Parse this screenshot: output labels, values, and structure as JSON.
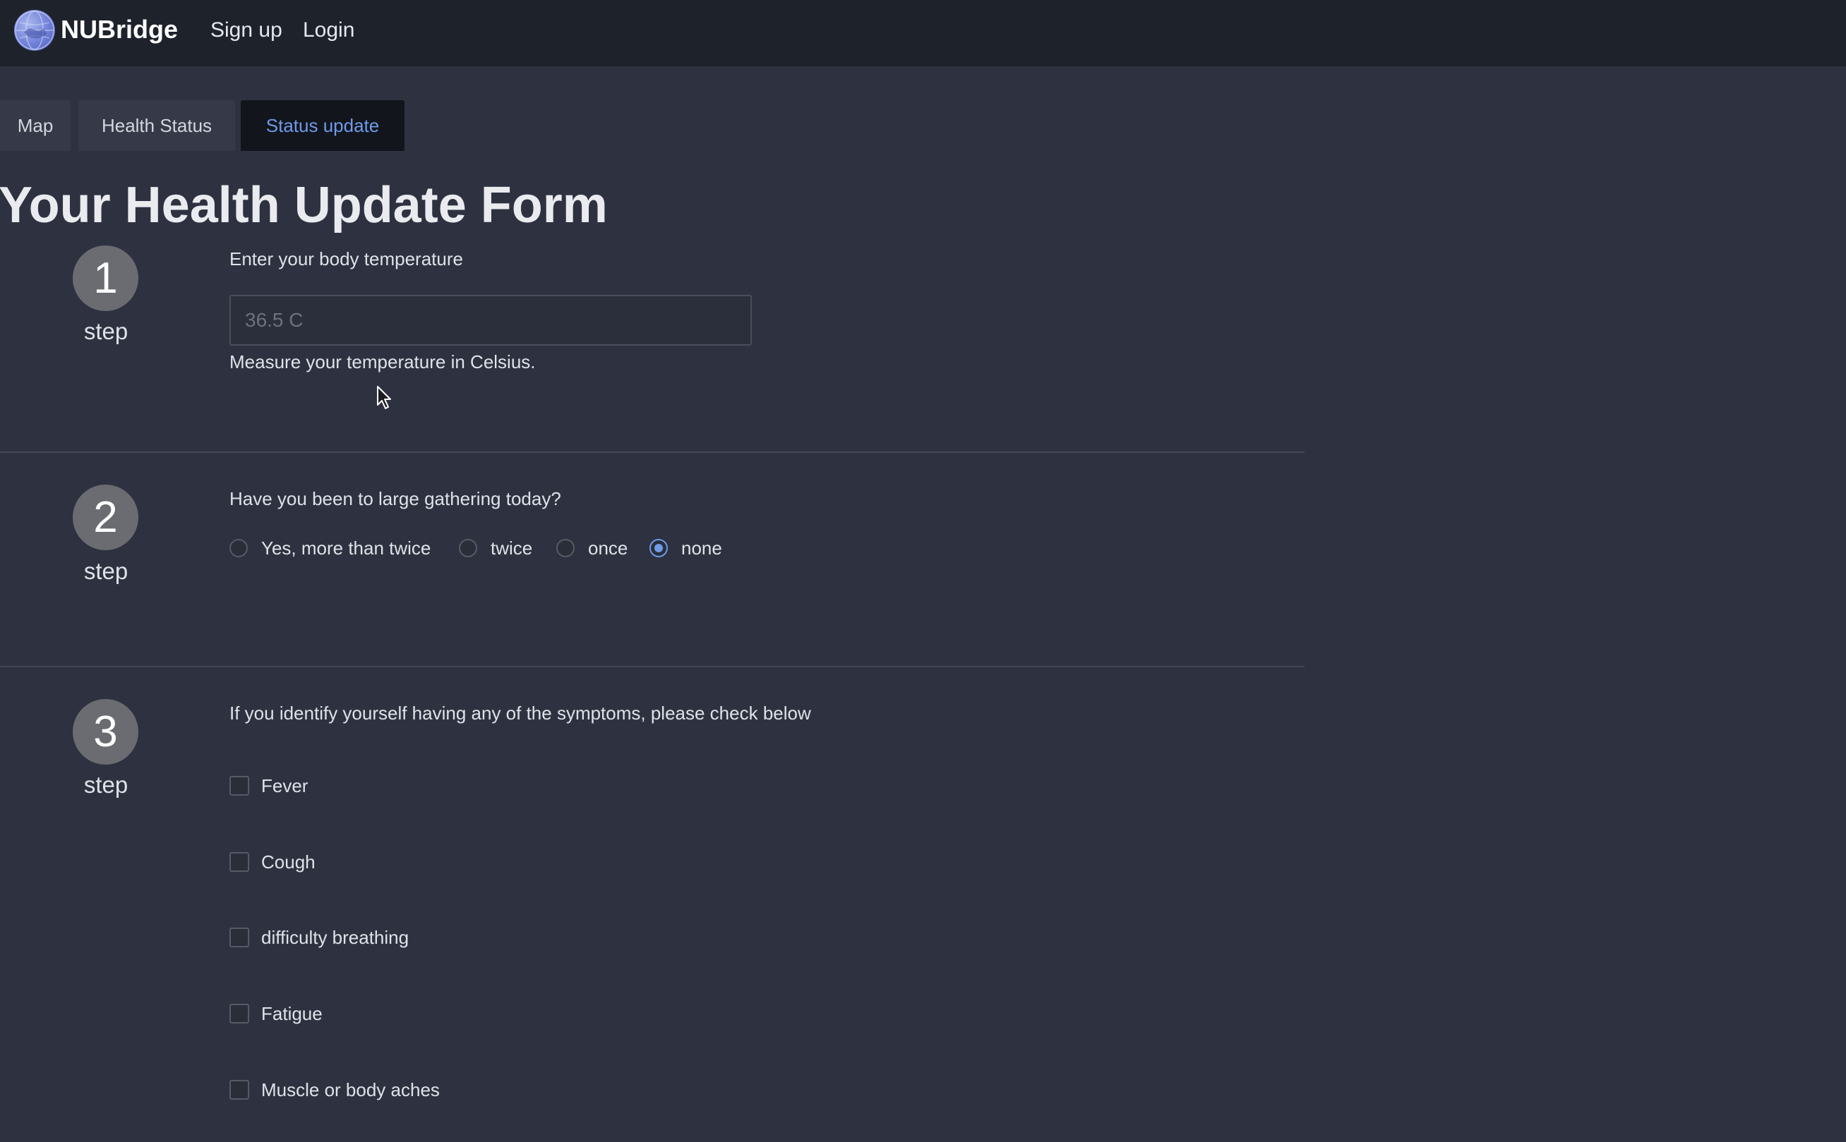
{
  "navbar": {
    "brand": "NUBridge",
    "logo_icon": "globe-icon",
    "links": [
      "Sign up",
      "Login"
    ]
  },
  "tabs": [
    {
      "label": "Map",
      "active": false
    },
    {
      "label": "Health Status",
      "active": false
    },
    {
      "label": "Status update",
      "active": true
    }
  ],
  "page_title": "Your Health Update Form",
  "step_word": "step",
  "steps": {
    "one": {
      "number": "1",
      "question": "Enter your body temperature",
      "input_placeholder": "36.5 C",
      "input_value": "",
      "helper": "Measure your temperature in Celsius."
    },
    "two": {
      "number": "2",
      "question": "Have you been to large gathering today?",
      "options": [
        {
          "label": "Yes, more than twice",
          "checked": false
        },
        {
          "label": "twice",
          "checked": false
        },
        {
          "label": "once",
          "checked": false
        },
        {
          "label": "none",
          "checked": true
        }
      ]
    },
    "three": {
      "number": "3",
      "question": "If you identify yourself having any of the symptoms, please check below",
      "symptoms": [
        {
          "label": "Fever",
          "checked": false
        },
        {
          "label": "Cough",
          "checked": false
        },
        {
          "label": "difficulty breathing",
          "checked": false
        },
        {
          "label": "Fatigue",
          "checked": false
        },
        {
          "label": "Muscle or body aches",
          "checked": false
        }
      ]
    }
  },
  "colors": {
    "background": "#2e3240",
    "navbar": "#1e222b",
    "accent": "#6e9ae8",
    "active_tab": "#12151c",
    "step_circle": "#6a6c72"
  }
}
